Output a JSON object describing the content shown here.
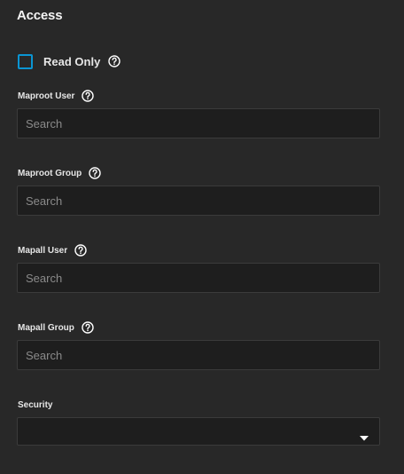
{
  "section": {
    "title": "Access"
  },
  "read_only": {
    "label": "Read Only",
    "checked": false
  },
  "maproot_user": {
    "label": "Maproot User",
    "placeholder": "Search",
    "value": ""
  },
  "maproot_group": {
    "label": "Maproot Group",
    "placeholder": "Search",
    "value": ""
  },
  "mapall_user": {
    "label": "Mapall User",
    "placeholder": "Search",
    "value": ""
  },
  "mapall_group": {
    "label": "Mapall Group",
    "placeholder": "Search",
    "value": ""
  },
  "security": {
    "label": "Security",
    "value": ""
  },
  "icons": {
    "help": "help-circle-icon",
    "dropdown": "caret-down-icon"
  },
  "colors": {
    "accent": "#0a95d3",
    "background": "#282828",
    "field_bg": "#1e1e1e"
  }
}
